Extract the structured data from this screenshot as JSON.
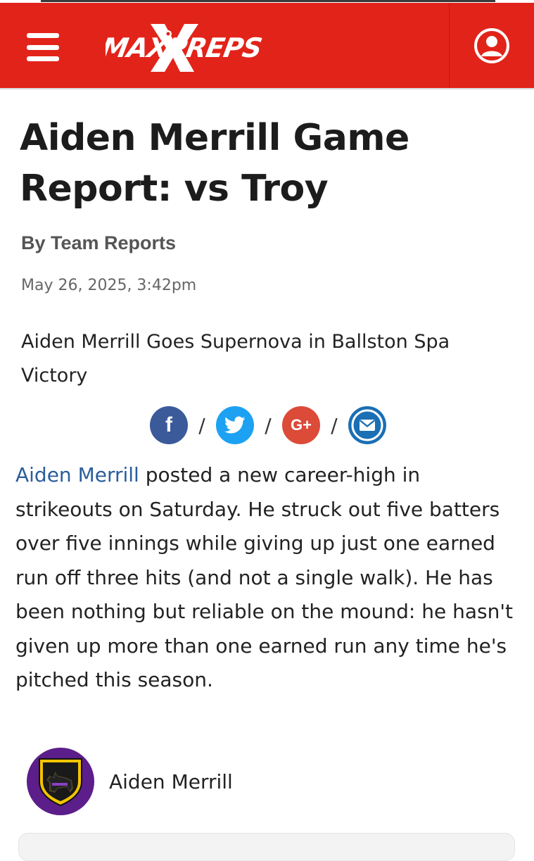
{
  "header": {
    "logo_text": "MAXPREPS",
    "brand_color": "#e2231a",
    "menu_icon": "hamburger-menu-icon",
    "account_icon": "user-account-icon"
  },
  "article": {
    "title": "Aiden Merrill Game Report: vs Troy",
    "byline": "By Team Reports",
    "date": "May 26, 2025, 3:42pm",
    "subtitle": "Aiden Merrill Goes Supernova in Ballston Spa Victory",
    "body_link": "Aiden Merrill",
    "body_rest": " posted a new career-high in strikeouts on Saturday. He struck out five batters over five innings while giving up just one earned run off three hits (and not a single walk). He has been nothing but reliable on the mound: he hasn't given up more than one earned run any time he's pitched this season."
  },
  "share": {
    "separator": "/",
    "buttons": [
      {
        "name": "facebook",
        "glyph": "f",
        "icon": "facebook-icon",
        "color": "#3b5a9a"
      },
      {
        "name": "twitter",
        "icon": "twitter-bird-icon",
        "color": "#1da1f2"
      },
      {
        "name": "google-plus",
        "glyph": "G+",
        "icon": "google-plus-icon",
        "color": "#dc4a38"
      },
      {
        "name": "email",
        "icon": "envelope-icon",
        "color": "#1a6fb5"
      }
    ]
  },
  "player": {
    "name": "Aiden Merrill",
    "avatar_icon": "scottie-dog-shield-logo",
    "avatar_color": "#5c1e8a"
  },
  "colors": {
    "link": "#2a5d9b",
    "text": "#222222",
    "muted": "#666666"
  }
}
